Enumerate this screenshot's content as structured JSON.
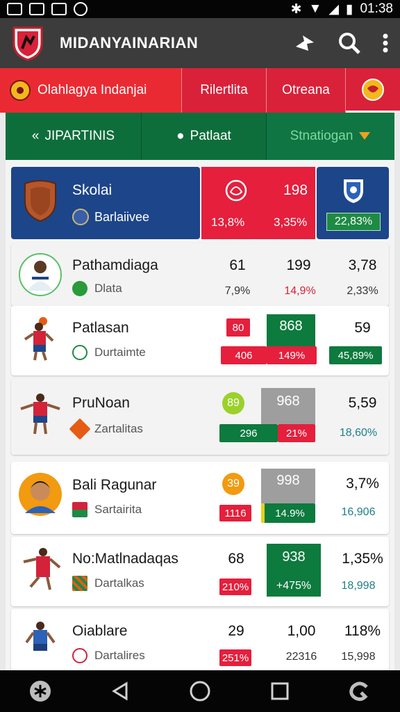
{
  "status_bar": {
    "time": "01:38"
  },
  "app_bar": {
    "title": "MIDANYAINARIAN"
  },
  "tabs": [
    {
      "label": "Olahlagya Indanjai"
    },
    {
      "label": "Rilertlita"
    },
    {
      "label": "Otreana"
    }
  ],
  "segments": [
    {
      "label": "JIPARTINIS"
    },
    {
      "label": "Patlaat"
    },
    {
      "label": "Stnatiogan"
    }
  ],
  "hero": {
    "name": "Skolai",
    "sub": "Barlaiivee",
    "value_main": "198",
    "pct_left": "13,8%",
    "pct_right": "3,35%",
    "pct_navy": "22,83%"
  },
  "players": [
    {
      "name": "Pathamdiaga",
      "sub": "Dlata",
      "v1": "61",
      "v2": "199",
      "v3": "3,78",
      "p1": "7,9%",
      "p2": "14,9%",
      "p3": "2,33%"
    },
    {
      "name": "Patlasan",
      "sub": "Durtaimte",
      "v1": "80",
      "v2": "868",
      "v3": "59",
      "p1": "406",
      "p2": "149%",
      "p3": "45,89%"
    },
    {
      "name": "PruNoan",
      "sub": "Zartalitas",
      "v1": "89",
      "v2": "968",
      "v3": "5,59",
      "p1": "296",
      "p2": "21%",
      "p3": "18,60%"
    },
    {
      "name": "Bali Ragunar",
      "sub": "Sartairita",
      "v1": "39",
      "v2": "998",
      "v3": "3,7%",
      "p1": "1116",
      "p2": "14.9%",
      "p3": "16,906"
    },
    {
      "name": "No:Matlnadaqas",
      "sub": "Dartalkas",
      "v1": "68",
      "v2": "938",
      "v3": "1,35%",
      "p1": "210%",
      "p2": "+475%",
      "p3": "18,998"
    },
    {
      "name": "Oiablare",
      "sub": "Dartalires",
      "v1": "29",
      "v2": "1,00",
      "v3": "118%",
      "p1": "251%",
      "p2": "22316",
      "p3": "15,998"
    }
  ]
}
